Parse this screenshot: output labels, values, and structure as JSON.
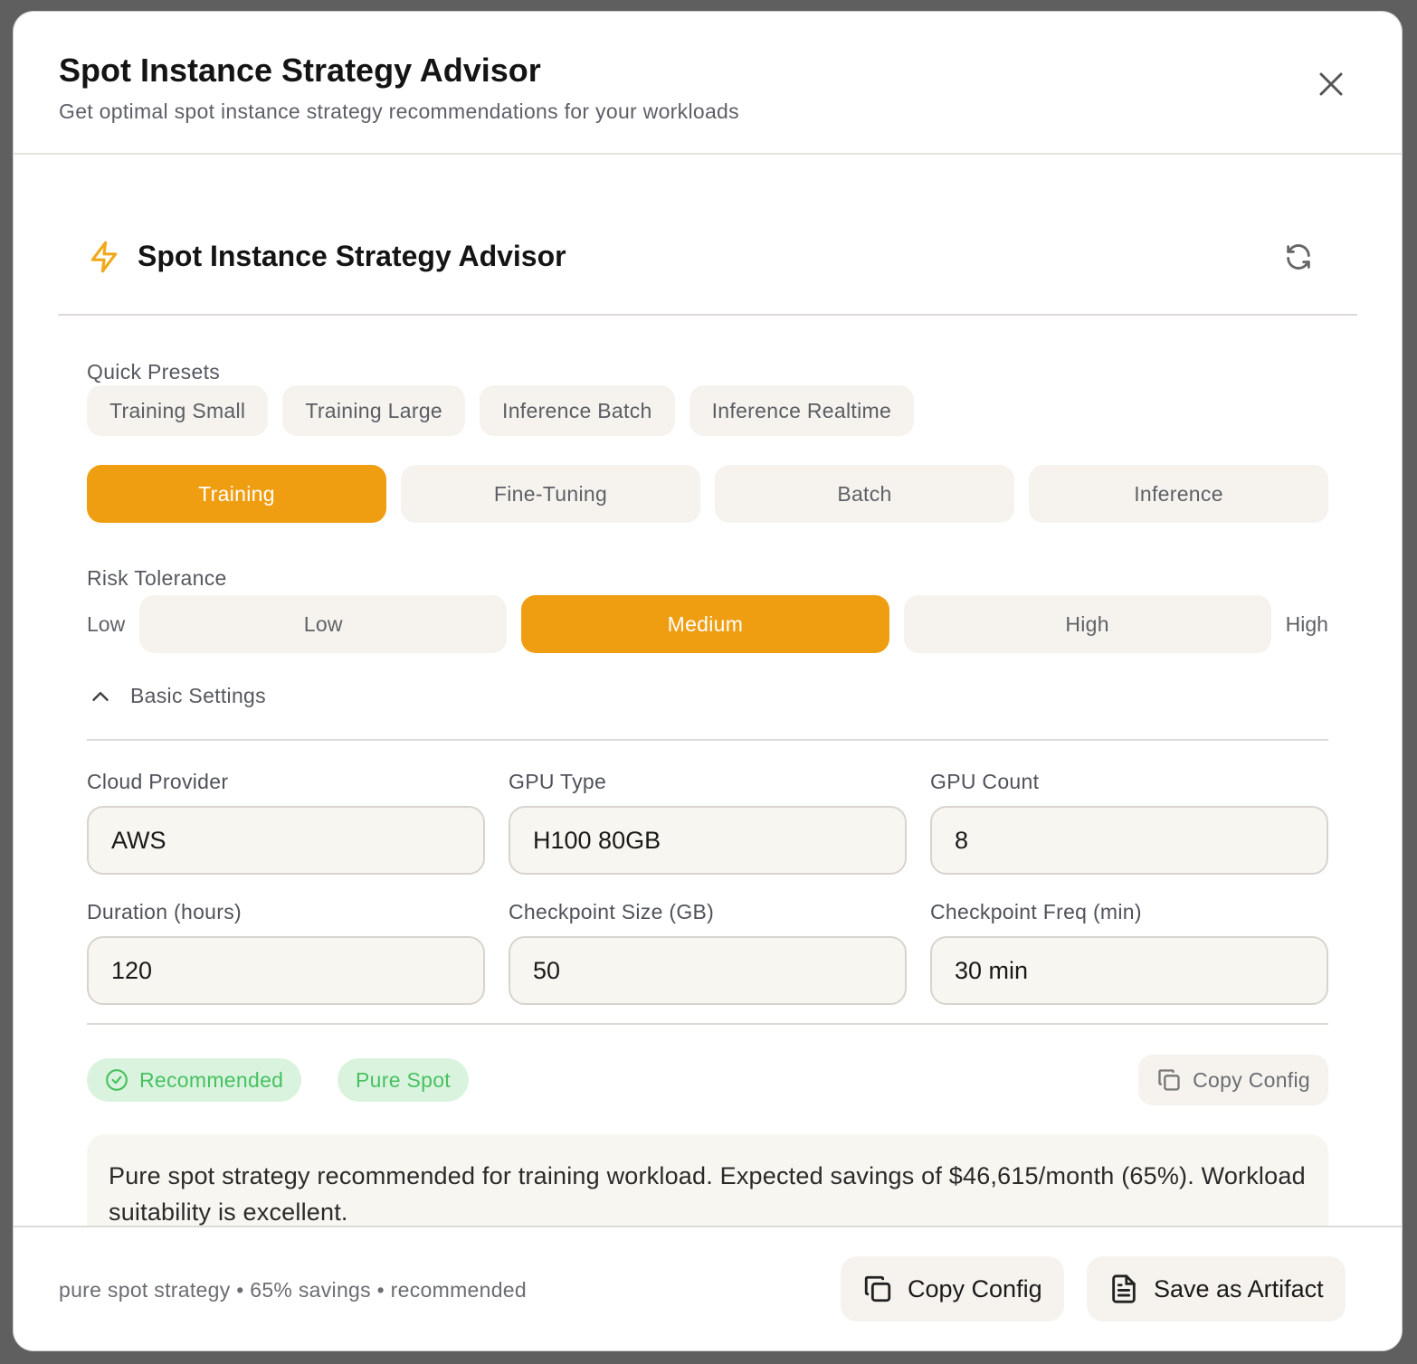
{
  "modal": {
    "title": "Spot Instance Strategy Advisor",
    "subtitle": "Get optimal spot instance strategy recommendations for your workloads"
  },
  "panel": {
    "title": "Spot Instance Strategy Advisor"
  },
  "presets": {
    "label": "Quick Presets",
    "items": [
      "Training Small",
      "Training Large",
      "Inference Batch",
      "Inference Realtime"
    ]
  },
  "workload_types": {
    "items": [
      "Training",
      "Fine-Tuning",
      "Batch",
      "Inference"
    ],
    "selected": "Training"
  },
  "risk": {
    "label": "Risk Tolerance",
    "low_end": "Low",
    "high_end": "High",
    "items": [
      "Low",
      "Medium",
      "High"
    ],
    "selected": "Medium"
  },
  "basic_settings": {
    "label": "Basic Settings",
    "fields": [
      {
        "label": "Cloud Provider",
        "value": "AWS"
      },
      {
        "label": "GPU Type",
        "value": "H100 80GB"
      },
      {
        "label": "GPU Count",
        "value": "8"
      },
      {
        "label": "Duration (hours)",
        "value": "120"
      },
      {
        "label": "Checkpoint Size (GB)",
        "value": "50"
      },
      {
        "label": "Checkpoint Freq (min)",
        "value": "30 min"
      }
    ]
  },
  "result": {
    "badge_recommended": "Recommended",
    "badge_strategy": "Pure Spot",
    "copy_config": "Copy Config",
    "summary": "Pure spot strategy recommended for training workload. Expected savings of $46,615/month (65%). Workload suitability is excellent."
  },
  "footer": {
    "status": "pure spot strategy • 65% savings • recommended",
    "copy_config": "Copy Config",
    "save_artifact": "Save as Artifact"
  },
  "colors": {
    "accent": "#f09e11",
    "success": "#47c160",
    "success_bg": "#daf3df"
  },
  "icons": [
    "close-icon",
    "bolt-icon",
    "refresh-icon",
    "chevron-up-icon",
    "check-circle-icon",
    "copy-icon",
    "document-icon"
  ]
}
